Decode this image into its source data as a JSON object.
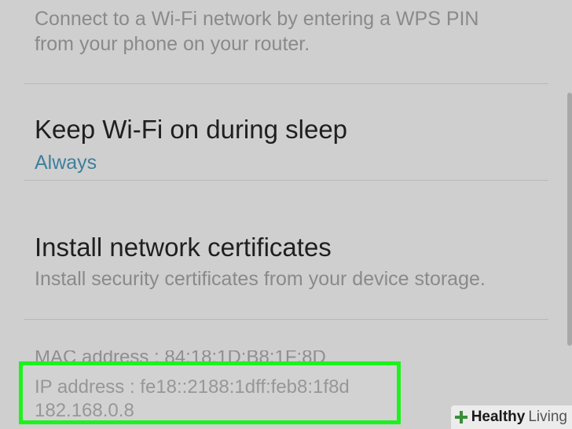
{
  "wps_pin": {
    "description_line1": "Connect to a Wi-Fi network by entering a WPS PIN",
    "description_line2": "from your phone on your router."
  },
  "keep_wifi": {
    "title": "Keep Wi-Fi on during sleep",
    "value": "Always"
  },
  "install_certs": {
    "title": "Install network certificates",
    "description": "Install security certificates from your device storage."
  },
  "network_info": {
    "mac_address": "MAC address : 84:18:1D:B8:1F:8D",
    "ip_address": "IP address : fe18::2188:1dff:feb8:1f8d",
    "ipv4": "182.168.0.8"
  },
  "watermark": {
    "brand_bold": "Healthy",
    "brand_light": "Living"
  },
  "colors": {
    "background": "#cfcfcf",
    "accent_value": "#3f7f9c",
    "highlight_border": "#1df21d"
  }
}
